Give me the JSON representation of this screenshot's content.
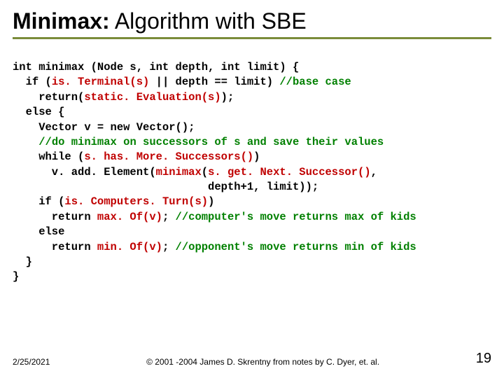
{
  "slide": {
    "title_bold": "Minimax:",
    "title_rest": " Algorithm with SBE"
  },
  "code": {
    "l1a": "int minimax (Node s, int depth, int limit) {",
    "l2a": "  if (",
    "l2b": "is. Terminal(s)",
    "l2c": " || depth == limit) ",
    "l2d": "//base case",
    "l3a": "    return(",
    "l3b": "static. Evaluation(s)",
    "l3c": ");",
    "l4a": "  else {",
    "l5a": "    Vector v = new Vector();",
    "l6a": "    ",
    "l6b": "//do minimax on successors of s and save their values",
    "l7a": "    while (",
    "l7b": "s. has. More. Successors()",
    "l7c": ")",
    "l8a": "      v. add. Element(",
    "l8b": "minimax",
    "l8c": "(",
    "l8d": "s. get. Next. Successor()",
    "l8e": ",",
    "l9a": "                              depth+1, limit));",
    "l10a": "    if (",
    "l10b": "is. Computers. Turn(s)",
    "l10c": ")",
    "l11a": "      return ",
    "l11b": "max. Of(v)",
    "l11c": "; ",
    "l11d": "//computer's move returns max of kids",
    "l12a": "    else",
    "l13a": "      return ",
    "l13b": "min. Of(v)",
    "l13c": "; ",
    "l13d": "//opponent's move returns min of kids",
    "l14a": "  }",
    "l15a": "}"
  },
  "footer": {
    "date": "2/25/2021",
    "copyright": "© 2001 -2004 James D. Skrentny from notes by C. Dyer, et. al.",
    "page": "19"
  }
}
